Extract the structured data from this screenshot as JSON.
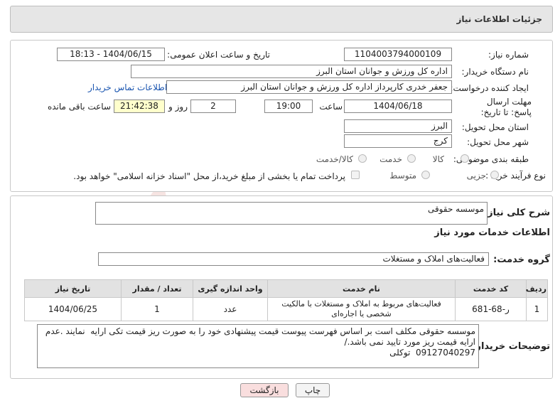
{
  "header": {
    "title": "جزئیات اطلاعات نیاز"
  },
  "fields": {
    "need_number_label": "شماره نیاز:",
    "need_number": "1104003794000109",
    "announce_label": "تاریخ و ساعت اعلان عمومی:",
    "announce_value": "1404/06/15 - 18:13",
    "buyer_label": "نام دستگاه خریدار:",
    "buyer_value": "اداره کل ورزش و جوانان استان البرز",
    "creator_label": "ایجاد کننده درخواست:",
    "creator_value": "جعفر خدری کارپرداز اداره کل ورزش و جوانان استان البرز",
    "contact_link": "اطلاعات تماس خریدار",
    "deadline_label": "مهلت ارسال پاسخ: تا تاریخ:",
    "deadline_date": "1404/06/18",
    "time_label": "ساعت",
    "deadline_time": "19:00",
    "days_value": "2",
    "days_label": "روز و",
    "remaining_time": "21:42:38",
    "remaining_label": "ساعت باقی مانده",
    "province_label": "استان محل تحویل:",
    "province_value": "البرز",
    "city_label": "شهر محل تحویل:",
    "city_value": "کرج",
    "category_label": "طبقه بندی موضوعی:",
    "category_options": [
      "کالا",
      "خدمت",
      "کالا/خدمت"
    ],
    "purchase_label": "نوع فرآیند خرید :",
    "purchase_options": [
      "جزیی",
      "متوسط"
    ],
    "payment_note": "پرداخت تمام یا بخشی از مبلغ خرید،از محل \"اسناد خزانه اسلامی\" خواهد بود."
  },
  "summary": {
    "label": "شرح کلی نیاز:",
    "value": "موسسه حقوقی"
  },
  "services_heading": "اطلاعات خدمات مورد نیاز",
  "service_group": {
    "label": "گروه خدمت:",
    "value": "فعالیت‌های  املاک و مستغلات"
  },
  "table": {
    "headers": [
      "ردیف",
      "کد خدمت",
      "نام خدمت",
      "واحد اندازه گیری",
      "تعداد / مقدار",
      "تاریخ نیاز"
    ],
    "rows": [
      [
        "1",
        "ر-68-681",
        "فعالیت‌های مربوط به املاک و مستغلات با مالکیت شخصی یا اجاره‌ای",
        "عدد",
        "1",
        "1404/06/25"
      ]
    ]
  },
  "buyer_notes": {
    "label": "توضیحات خریدار:",
    "value": "موسسه حقوقی مکلف است بر اساس فهرست پیوست قیمت پیشنهادی خود را به صورت ریز قیمت تکی ارایه  نمایند .عدم ارایه قیمت ریز مورد تایید نمی باشد./\n09127040297  توکلی"
  },
  "buttons": {
    "print": "چاپ",
    "back": "بازگشت"
  },
  "watermark": {
    "text": "AriaTender.neT"
  },
  "colors": {
    "link": "#1a55b0",
    "watermark": "#c0392b",
    "back_button_bg": "#f9dede"
  }
}
